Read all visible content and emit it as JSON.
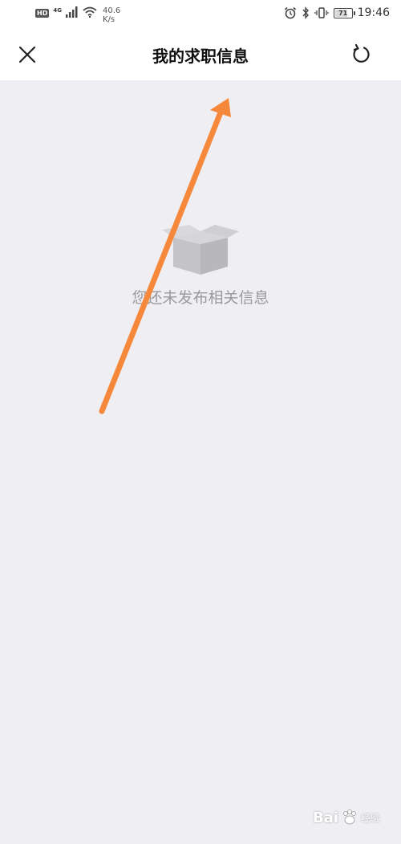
{
  "status_bar": {
    "hd": "HD",
    "network": "4G",
    "speed_value": "40.6",
    "speed_unit": "K/s",
    "battery": "71",
    "time": "19:46"
  },
  "nav": {
    "title": "我的求职信息"
  },
  "empty_state": {
    "message": "您还未发布相关信息"
  },
  "annotation": {
    "arrow_color": "#f5883a"
  },
  "watermark": {
    "brand": "Bai",
    "sub": "经验"
  }
}
